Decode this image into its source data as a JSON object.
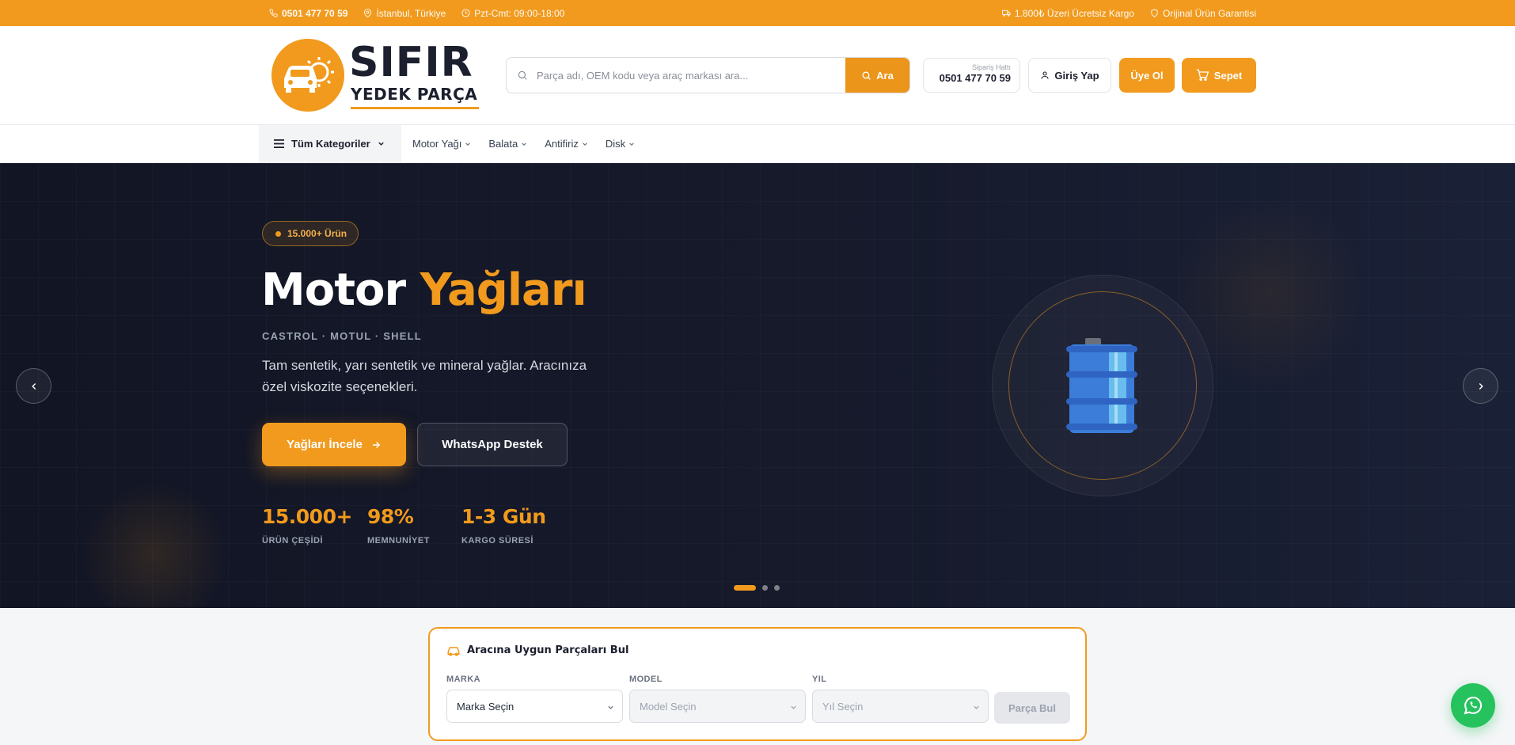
{
  "topbar": {
    "phone": "0501 477 70 59",
    "location": "İstanbul, Türkiye",
    "hours": "Pzt-Cmt: 09:00-18:00",
    "shipping": "1.800₺ Üzeri Ücretsiz Kargo",
    "guarantee": "Orijinal Ürün Garantisi"
  },
  "header": {
    "logo_title": "SIFIR",
    "logo_subtitle": "YEDEK PARÇA",
    "search_placeholder": "Parça adı, OEM kodu veya araç markası ara...",
    "search_button": "Ara",
    "hotline_label": "Sipariş Hattı",
    "hotline_number": "0501 477 70 59",
    "login": "Giriş Yap",
    "register": "Üye Ol",
    "cart": "Sepet"
  },
  "nav": {
    "all_categories": "Tüm Kategoriler",
    "items": [
      "Motor Yağı",
      "Balata",
      "Antifiriz",
      "Disk"
    ]
  },
  "hero": {
    "badge": "15.000+ Ürün",
    "title_white": "Motor",
    "title_accent": "Yağları",
    "brands": "CASTROL · MOTUL · SHELL",
    "description": "Tam sentetik, yarı sentetik ve mineral yağlar. Aracınıza özel viskozite seçenekleri.",
    "primary_cta": "Yağları İncele",
    "secondary_cta": "WhatsApp Destek",
    "stats": [
      {
        "value": "15.000+",
        "label": "ÜRÜN ÇEŞİDİ"
      },
      {
        "value": "98%",
        "label": "MEMNUNİYET"
      },
      {
        "value": "1-3 Gün",
        "label": "KARGO SÜRESİ"
      }
    ],
    "slides_count": 3,
    "active_slide": 1
  },
  "finder": {
    "title": "Aracına Uygun Parçaları Bul",
    "brand_label": "MARKA",
    "brand_value": "Marka Seçin",
    "model_label": "MODEL",
    "model_value": "Model Seçin",
    "year_label": "YIL",
    "year_value": "Yıl Seçin",
    "button": "Parça Bul"
  },
  "colors": {
    "accent": "#f19a1d",
    "hero_bg": "#141828",
    "whatsapp": "#25c25e"
  }
}
